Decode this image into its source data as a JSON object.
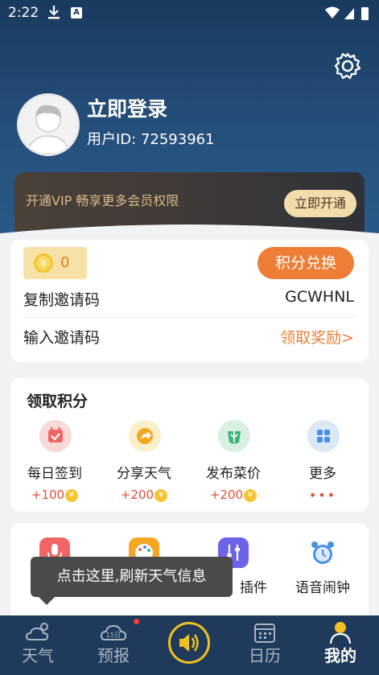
{
  "status": {
    "time": "2:22",
    "a_badge": "A"
  },
  "profile": {
    "title": "立即登录",
    "user_id": "用户ID: 72593961"
  },
  "vip": {
    "text": "开通VIP  畅享更多会员权限",
    "button": "立即开通"
  },
  "points": {
    "coins": "0",
    "exchange_button": "积分兑换",
    "copy_label": "复制邀请码",
    "copy_value": "GCWHNL",
    "input_label": "输入邀请码",
    "input_link": "领取奖励>"
  },
  "earn": {
    "title": "领取积分",
    "tasks": [
      {
        "label": "每日签到",
        "reward": "+100",
        "icon": "calendar-check-icon",
        "color": "#f6d9d9"
      },
      {
        "label": "分享天气",
        "reward": "+200",
        "icon": "share-icon",
        "color": "#f9efc9"
      },
      {
        "label": "发布菜价",
        "reward": "+200",
        "icon": "vegetable-icon",
        "color": "#d8efe2"
      },
      {
        "label": "更多",
        "reward": "•••",
        "icon": "grid-icon",
        "color": "#dce8f7"
      }
    ]
  },
  "tools": [
    {
      "label": "",
      "icon": "microphone-icon"
    },
    {
      "label": "",
      "icon": "palette-icon"
    },
    {
      "label": "插件",
      "icon": "sliders-icon"
    },
    {
      "label": "语音闹钟",
      "icon": "alarm-clock-icon"
    }
  ],
  "tooltip": {
    "text": "点击这里,刷新天气信息"
  },
  "tabs": [
    {
      "label": "天气",
      "icon": "weather-icon",
      "active": false
    },
    {
      "label": "预报",
      "icon": "forecast-15day-icon",
      "badge": "15日",
      "active": false
    },
    {
      "label": "",
      "icon": "speaker-icon",
      "active": false
    },
    {
      "label": "日历",
      "icon": "calendar-icon",
      "active": false
    },
    {
      "label": "我的",
      "icon": "profile-icon",
      "active": true
    }
  ],
  "colors": {
    "accent": "#ee7e35",
    "header": "#1a3a5e",
    "tabbar": "#1f3a5a",
    "gold": "#f0c020"
  }
}
